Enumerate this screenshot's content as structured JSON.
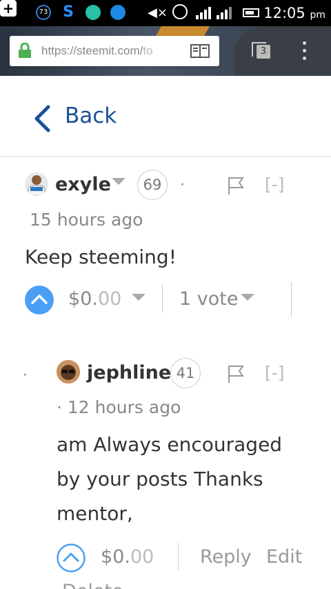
{
  "status_bar": {
    "badge_count": "73",
    "time": "12:05",
    "ampm": "pm"
  },
  "browser": {
    "url_host": "https://steemit.com/",
    "url_fade": "to",
    "tab_count": "3"
  },
  "nav": {
    "back_label": "Back"
  },
  "comments": [
    {
      "username": "exyle",
      "reputation": "69",
      "timestamp": "15 hours ago",
      "body": "Keep steeming!",
      "payout_prefix": "$",
      "payout_main": "0.",
      "payout_cents": "00",
      "votes": "1 vote",
      "collapse": "[-]"
    },
    {
      "bullet": "·",
      "username": "jephline",
      "reputation": "41",
      "timestamp": "· 12 hours ago",
      "body_lines": [
        "am Always encouraged",
        "by your posts Thanks",
        "mentor,"
      ],
      "payout_prefix": "$",
      "payout_main": "0.",
      "payout_cents": "00",
      "reply_label": "Reply",
      "edit_label": "Edit",
      "delete_label": "Delete",
      "collapse": "[-]"
    }
  ],
  "colors": {
    "link": "#1a5099",
    "upvote_active": "#4a9ff5",
    "upvote_outline": "#4a9ff5",
    "lock": "#4caf50"
  }
}
